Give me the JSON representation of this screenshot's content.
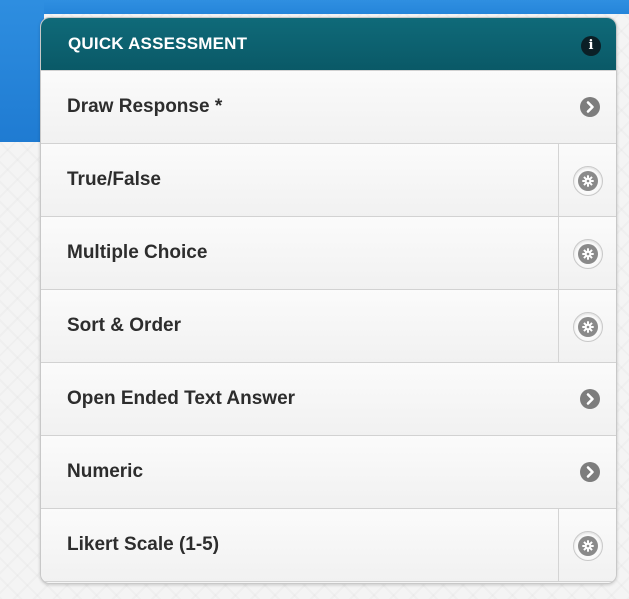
{
  "panel": {
    "title": "QUICK ASSESSMENT",
    "info_icon": "info-icon",
    "colors": {
      "header": "#0d6472",
      "text": "#2d2d2d",
      "chevron": "#7d7d7d"
    }
  },
  "items": [
    {
      "label": "Draw Response *",
      "action": "chevron"
    },
    {
      "label": "True/False",
      "action": "gear"
    },
    {
      "label": "Multiple Choice",
      "action": "gear"
    },
    {
      "label": "Sort & Order",
      "action": "gear"
    },
    {
      "label": "Open Ended Text Answer",
      "action": "chevron"
    },
    {
      "label": "Numeric",
      "action": "chevron"
    },
    {
      "label": "Likert Scale (1-5)",
      "action": "gear"
    }
  ]
}
